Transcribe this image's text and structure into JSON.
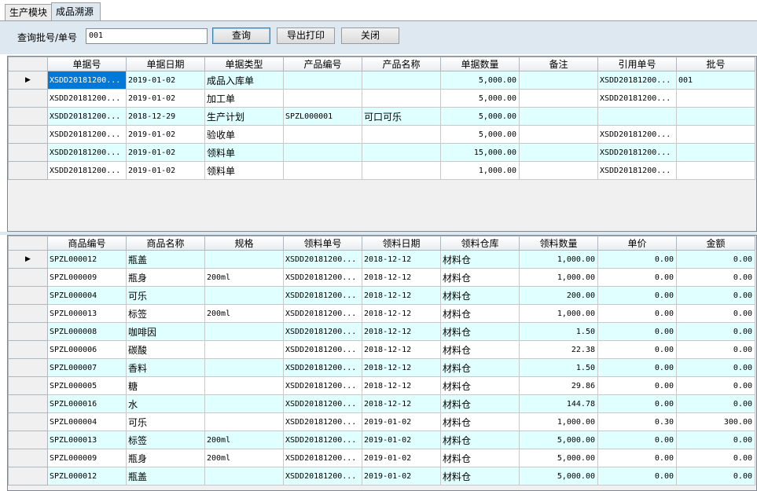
{
  "tabs": [
    {
      "label": "生产模块"
    },
    {
      "label": "成品溯源"
    }
  ],
  "toolbar": {
    "query_label": "查询批号/单号",
    "query_value": "001",
    "query_button": "查询",
    "export_button": "导出打印",
    "close_button": "关闭"
  },
  "grid1": {
    "columns": [
      "单据号",
      "单据日期",
      "单据类型",
      "产品编号",
      "产品名称",
      "单据数量",
      "备注",
      "引用单号",
      "批号"
    ],
    "rows": [
      [
        "XSDD20181200...",
        "2019-01-02",
        "成品入库单",
        "",
        "",
        "5,000.00",
        "",
        "XSDD20181200...",
        "001"
      ],
      [
        "XSDD20181200...",
        "2019-01-02",
        "加工单",
        "",
        "",
        "5,000.00",
        "",
        "XSDD20181200...",
        ""
      ],
      [
        "XSDD20181200...",
        "2018-12-29",
        "生产计划",
        "SPZL000001",
        "可口可乐",
        "5,000.00",
        "",
        "",
        ""
      ],
      [
        "XSDD20181200...",
        "2019-01-02",
        "验收单",
        "",
        "",
        "5,000.00",
        "",
        "XSDD20181200...",
        ""
      ],
      [
        "XSDD20181200...",
        "2019-01-02",
        "领料单",
        "",
        "",
        "15,000.00",
        "",
        "XSDD20181200...",
        ""
      ],
      [
        "XSDD20181200...",
        "2019-01-02",
        "领料单",
        "",
        "",
        "1,000.00",
        "",
        "XSDD20181200...",
        ""
      ]
    ]
  },
  "grid2": {
    "columns": [
      "商品编号",
      "商品名称",
      "规格",
      "领料单号",
      "领料日期",
      "领料仓库",
      "领料数量",
      "单价",
      "金额"
    ],
    "rows": [
      [
        "SPZL000012",
        "瓶盖",
        "",
        "XSDD20181200...",
        "2018-12-12",
        "材料仓",
        "1,000.00",
        "0.00",
        "0.00"
      ],
      [
        "SPZL000009",
        "瓶身",
        "200ml",
        "XSDD20181200...",
        "2018-12-12",
        "材料仓",
        "1,000.00",
        "0.00",
        "0.00"
      ],
      [
        "SPZL000004",
        "可乐",
        "",
        "XSDD20181200...",
        "2018-12-12",
        "材料仓",
        "200.00",
        "0.00",
        "0.00"
      ],
      [
        "SPZL000013",
        "标签",
        "200ml",
        "XSDD20181200...",
        "2018-12-12",
        "材料仓",
        "1,000.00",
        "0.00",
        "0.00"
      ],
      [
        "SPZL000008",
        "咖啡因",
        "",
        "XSDD20181200...",
        "2018-12-12",
        "材料仓",
        "1.50",
        "0.00",
        "0.00"
      ],
      [
        "SPZL000006",
        "碳酸",
        "",
        "XSDD20181200...",
        "2018-12-12",
        "材料仓",
        "22.38",
        "0.00",
        "0.00"
      ],
      [
        "SPZL000007",
        "香料",
        "",
        "XSDD20181200...",
        "2018-12-12",
        "材料仓",
        "1.50",
        "0.00",
        "0.00"
      ],
      [
        "SPZL000005",
        "糖",
        "",
        "XSDD20181200...",
        "2018-12-12",
        "材料仓",
        "29.86",
        "0.00",
        "0.00"
      ],
      [
        "SPZL000016",
        "水",
        "",
        "XSDD20181200...",
        "2018-12-12",
        "材料仓",
        "144.78",
        "0.00",
        "0.00"
      ],
      [
        "SPZL000004",
        "可乐",
        "",
        "XSDD20181200...",
        "2019-01-02",
        "材料仓",
        "1,000.00",
        "0.30",
        "300.00"
      ],
      [
        "SPZL000013",
        "标签",
        "200ml",
        "XSDD20181200...",
        "2019-01-02",
        "材料仓",
        "5,000.00",
        "0.00",
        "0.00"
      ],
      [
        "SPZL000009",
        "瓶身",
        "200ml",
        "XSDD20181200...",
        "2019-01-02",
        "材料仓",
        "5,000.00",
        "0.00",
        "0.00"
      ],
      [
        "SPZL000012",
        "瓶盖",
        "",
        "XSDD20181200...",
        "2019-01-02",
        "材料仓",
        "5,000.00",
        "0.00",
        "0.00"
      ]
    ]
  },
  "icons": {
    "current_row_marker": "triangle-right-icon"
  }
}
